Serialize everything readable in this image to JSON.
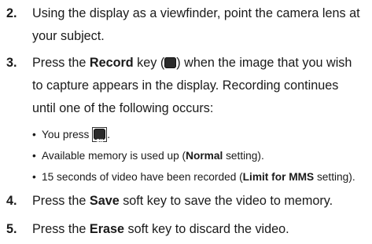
{
  "steps": [
    {
      "num": "2.",
      "line1": "Using the display as a viewfinder, point the camera lens at",
      "line2": "your subject."
    },
    {
      "num": "3.",
      "pre": "Press the ",
      "bold": "Record",
      "mid": " key (",
      "post": ") when the image that you wish",
      "line2": "to capture appears in the display. Recording continues",
      "line3": "until one of the following occurs:"
    },
    {
      "num": "4.",
      "pre": "Press the ",
      "bold": "Save",
      "post": " soft key to save the video to memory."
    },
    {
      "num": "5.",
      "pre": "Press the ",
      "bold": "Erase",
      "post": " soft key to discard the video."
    }
  ],
  "bullets": [
    {
      "text": "You press ",
      "suffix": "."
    },
    {
      "pre": "Available memory is used up (",
      "bold": "Normal",
      "post": " setting)."
    },
    {
      "pre": "15 seconds of video have been recorded (",
      "bold": "Limit for MMS",
      "post": " setting)."
    }
  ],
  "icons": {
    "ok_key": "ok-key-icon"
  },
  "colors": {
    "text": "#1a1a1a",
    "key": "#2b2b2b"
  }
}
